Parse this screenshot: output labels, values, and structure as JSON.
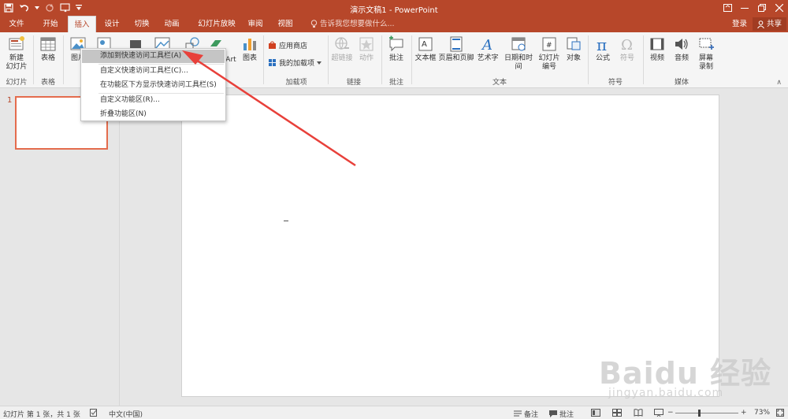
{
  "window": {
    "title": "演示文稿1 - PowerPoint",
    "accent": "#b7472a"
  },
  "tabs": [
    {
      "label": "文件",
      "active": false
    },
    {
      "label": "开始",
      "active": false
    },
    {
      "label": "插入",
      "active": true
    },
    {
      "label": "设计",
      "active": false
    },
    {
      "label": "切换",
      "active": false
    },
    {
      "label": "动画",
      "active": false
    },
    {
      "label": "幻灯片放映",
      "active": false
    },
    {
      "label": "审阅",
      "active": false
    },
    {
      "label": "视图",
      "active": false
    }
  ],
  "tell_me": "告诉我您想要做什么...",
  "account": {
    "login": "登录",
    "share": "共享"
  },
  "ribbon": {
    "new_slide": "新建\n幻灯片",
    "table": "表格",
    "picture": "图片",
    "smartart": "Art",
    "chart": "图表",
    "app_store": "应用商店",
    "my_addins": "我的加载项",
    "hyperlink": "超链接",
    "action": "动作",
    "comment": "批注",
    "textbox": "文本框",
    "header_footer": "页眉和页脚",
    "wordart": "艺术字",
    "datetime": "日期和时间",
    "slide_number": "幻灯片\n编号",
    "object": "对象",
    "equation": "公式",
    "symbol": "符号",
    "video": "视频",
    "audio": "音频",
    "screen_recording": "屏幕\n录制",
    "groups": {
      "slides": "幻灯片",
      "tables": "表格",
      "addins": "加载项",
      "links": "链接",
      "comments": "批注",
      "text": "文本",
      "symbols": "符号",
      "media": "媒体"
    }
  },
  "context_menu": {
    "items": [
      "添加到快速访问工具栏(A)",
      "自定义快速访问工具栏(C)...",
      "在功能区下方显示快速访问工具栏(S)",
      "自定义功能区(R)...",
      "折叠功能区(N)"
    ],
    "highlighted_index": 0
  },
  "thumbnails": {
    "slide_number": "1"
  },
  "status": {
    "slide_info": "幻灯片 第 1 张，共 1 张",
    "language": "中文(中国)",
    "notes": "备注",
    "comments": "批注",
    "zoom": "73%",
    "zoom_minus": "−",
    "zoom_plus": "+"
  },
  "watermark": {
    "brand": "Baidu 经验",
    "url": "jingyan.baidu.com"
  }
}
